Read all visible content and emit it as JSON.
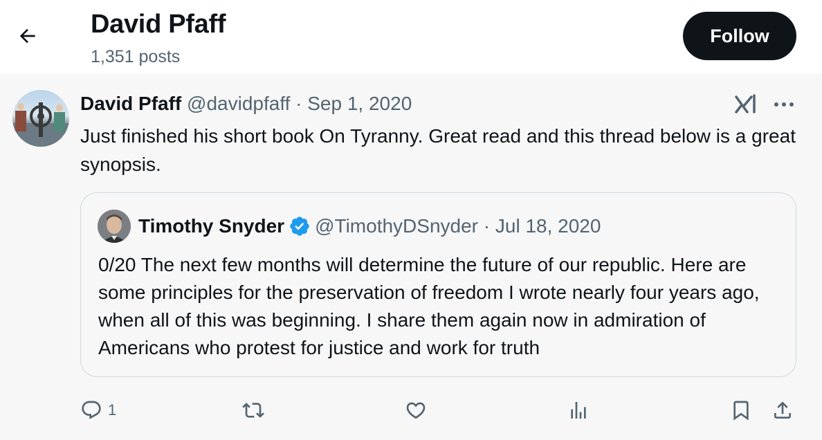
{
  "header": {
    "back_icon": "arrow-left-icon",
    "name": "David Pfaff",
    "posts": "1,351 posts",
    "follow_label": "Follow"
  },
  "tweet": {
    "author_name": "David Pfaff",
    "author_meta": "@davidpfaff · Sep 1, 2020",
    "text": "Just finished his short book On Tyranny. Great read and this thread below is a great synopsis.",
    "icons": [
      "grok-icon",
      "more-icon"
    ]
  },
  "quote": {
    "author_name": "Timothy Snyder",
    "author_meta": "@TimothyDSnyder · Jul 18, 2020",
    "text": "0/20 The next few months will determine the future of our republic. Here are some principles for the preservation of freedom I wrote nearly four years ago, when all of this was beginning. I share them again now in admiration of Americans who protest for justice and work for truth",
    "verified_color": "#1d9bf0"
  },
  "actions": {
    "reply_count": "1",
    "icons": [
      "reply-icon",
      "retweet-icon",
      "like-icon",
      "views-icon",
      "bookmark-icon",
      "share-icon"
    ]
  }
}
